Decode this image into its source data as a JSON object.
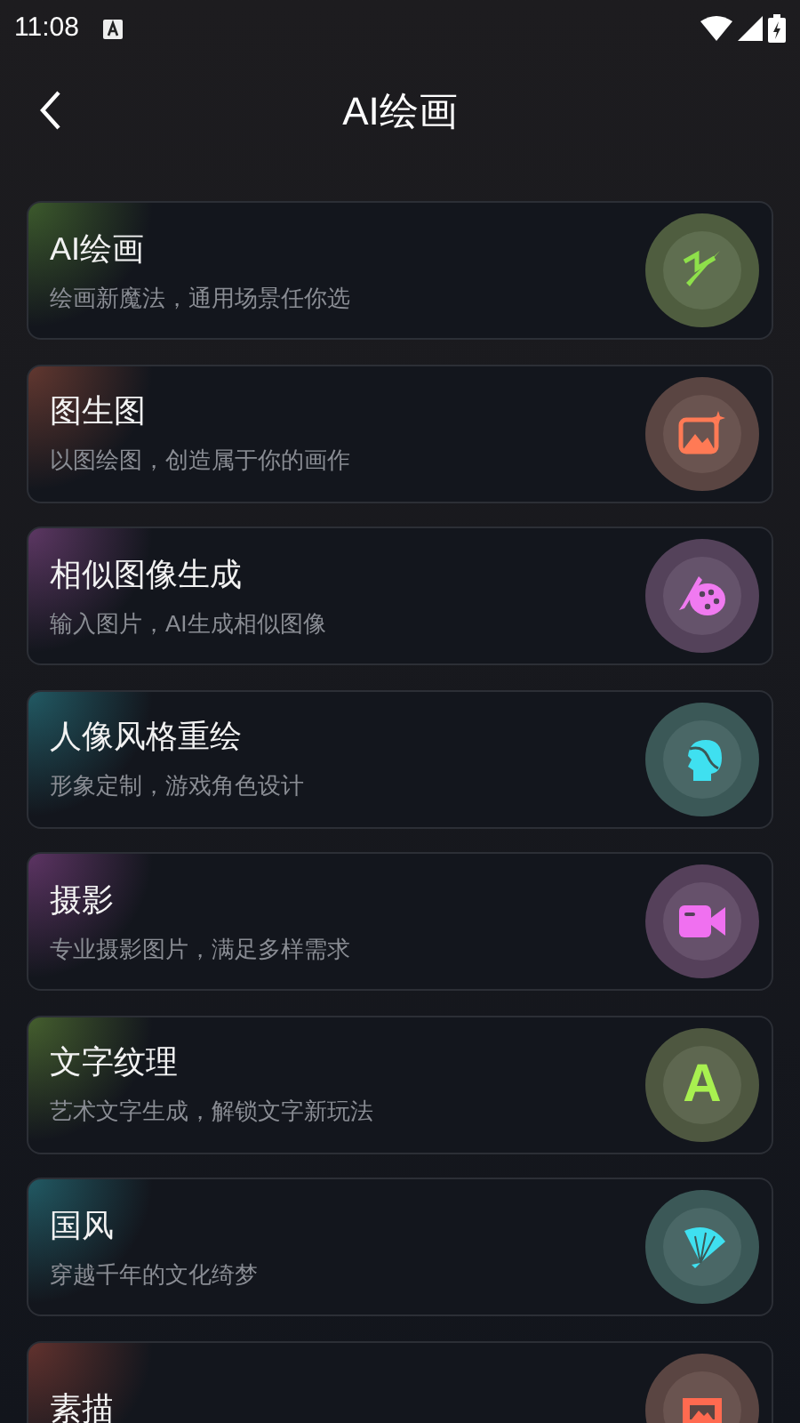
{
  "status_bar": {
    "time": "11:08"
  },
  "header": {
    "title": "AI绘画"
  },
  "items": [
    {
      "title": "AI绘画",
      "subtitle": "绘画新魔法，通用场景任你选",
      "kind": "pen",
      "color": "#8ee04a"
    },
    {
      "title": "图生图",
      "subtitle": "以图绘图，创造属于你的画作",
      "kind": "image",
      "color": "#ff7a55"
    },
    {
      "title": "相似图像生成",
      "subtitle": "输入图片，AI生成相似图像",
      "kind": "palette",
      "color": "#f07af0"
    },
    {
      "title": "人像风格重绘",
      "subtitle": "形象定制，游戏角色设计",
      "kind": "portrait",
      "color": "#3fe0f0"
    },
    {
      "title": "摄影",
      "subtitle": "专业摄影图片，满足多样需求",
      "kind": "camera",
      "color": "#f070f0"
    },
    {
      "title": "文字纹理",
      "subtitle": "艺术文字生成，解锁文字新玩法",
      "kind": "letter",
      "glyph": "A",
      "color": "#a8f050"
    },
    {
      "title": "国风",
      "subtitle": "穿越千年的文化绮梦",
      "kind": "fan",
      "color": "#3fe0f0"
    },
    {
      "title": "素描",
      "kind": "frame",
      "color": "#ff6a50"
    }
  ]
}
